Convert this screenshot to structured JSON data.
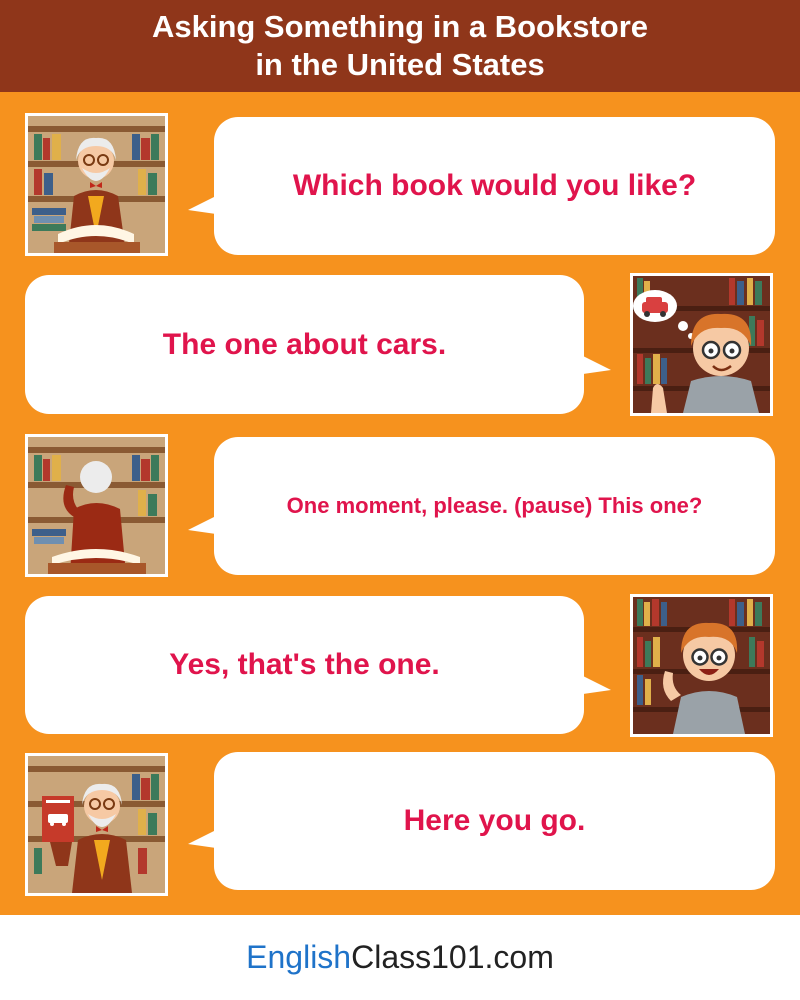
{
  "header": {
    "title_line1": "Asking Something in a Bookstore",
    "title_line2": "in the United States"
  },
  "dialogue": [
    {
      "speaker": "shopkeeper",
      "text": "Which book would you like?"
    },
    {
      "speaker": "customer",
      "text": "The one about cars."
    },
    {
      "speaker": "shopkeeper",
      "text": "One moment, please. (pause) This one?"
    },
    {
      "speaker": "customer",
      "text": "Yes, that's the one."
    },
    {
      "speaker": "shopkeeper",
      "text": "Here you go."
    }
  ],
  "footer": {
    "brand_part1": "English",
    "brand_part2": "Class101.com"
  },
  "colors": {
    "header_bg": "#8f361a",
    "body_bg": "#f6921e",
    "dialogue_text": "#e0144c",
    "brand_blue": "#1f73c9"
  }
}
